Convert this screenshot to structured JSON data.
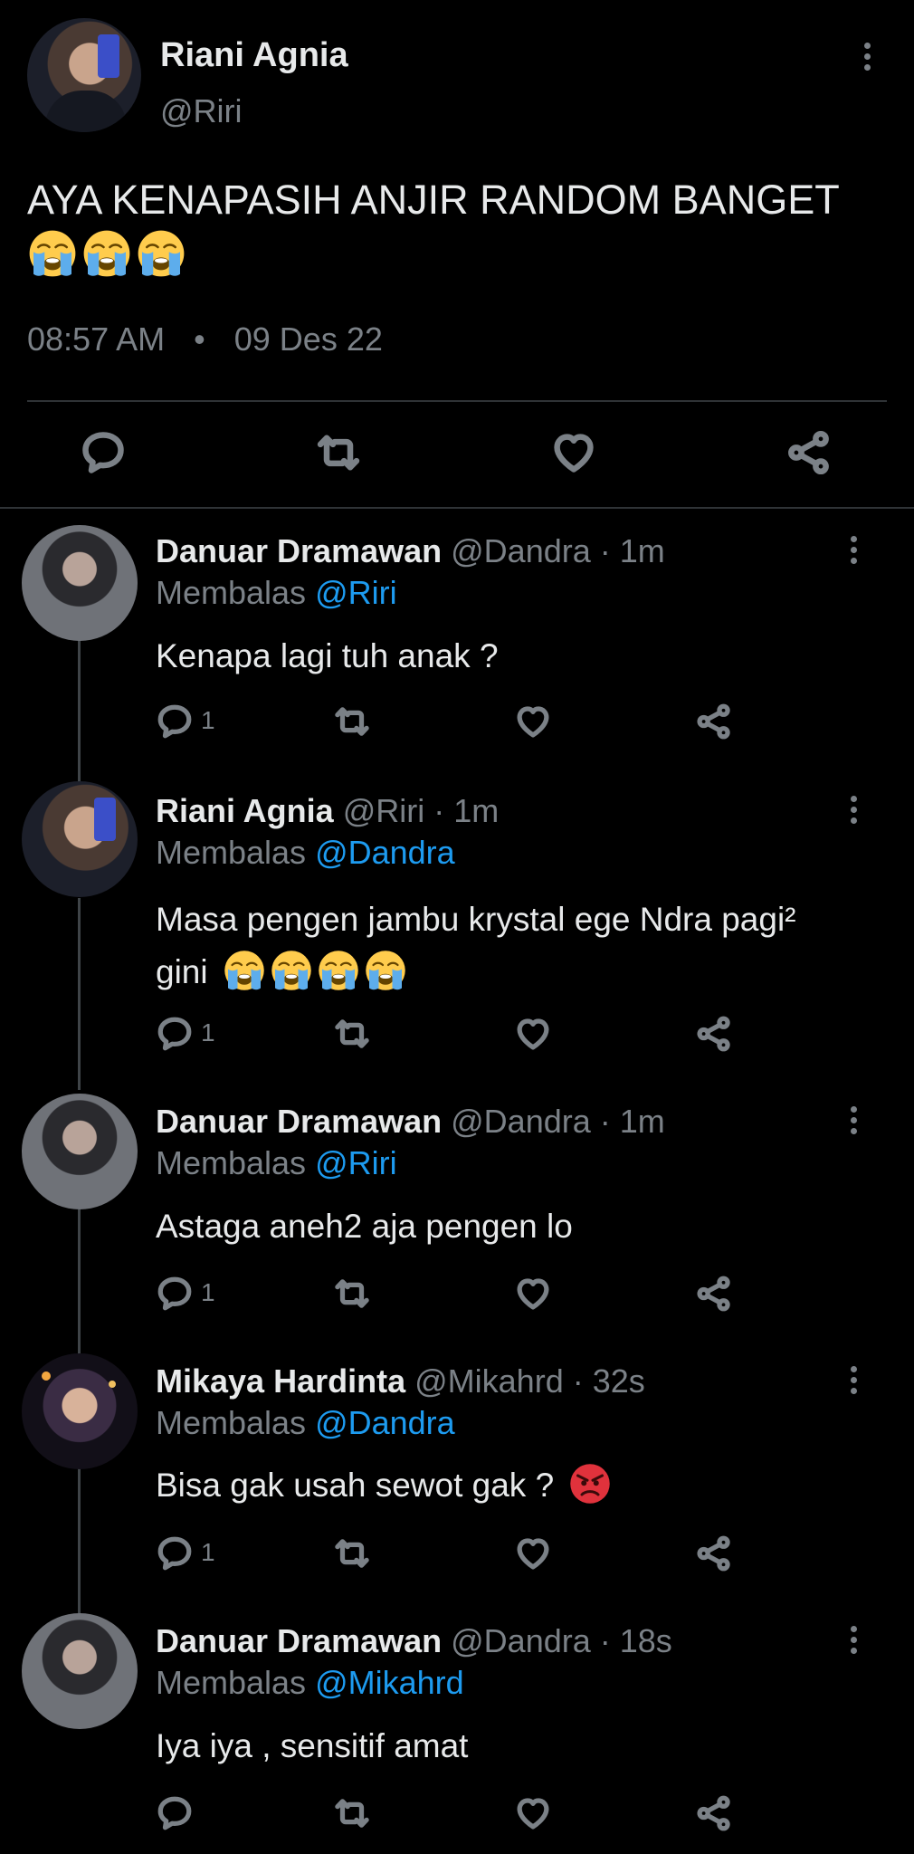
{
  "main_tweet": {
    "name": "Riani Agnia",
    "handle": "@Riri",
    "text": "AYA KENAPASIH ANJIR RANDOM BANGET",
    "emoji": [
      "loudly-crying-face",
      "loudly-crying-face",
      "loudly-crying-face"
    ],
    "time": "08:57 AM",
    "separator": "•",
    "date": "09 Des 22"
  },
  "replies": [
    {
      "name": "Danuar Dramawan",
      "meta": "@Dandra · 1m",
      "reply_prefix": "Membalas",
      "reply_to": "@Riri",
      "text": "Kenapa lagi tuh anak ?",
      "reply_count": "1"
    },
    {
      "name": "Riani Agnia",
      "meta": "@Riri · 1m",
      "reply_prefix": "Membalas",
      "reply_to": "@Dandra",
      "text_line1": "Masa pengen jambu krystal ege Ndra pagi²",
      "text_line2": "gini",
      "emoji": [
        "loudly-crying-face",
        "loudly-crying-face",
        "loudly-crying-face",
        "loudly-crying-face"
      ],
      "reply_count": "1"
    },
    {
      "name": "Danuar Dramawan",
      "meta": "@Dandra · 1m",
      "reply_prefix": "Membalas",
      "reply_to": "@Riri",
      "text": "Astaga aneh2 aja pengen lo",
      "reply_count": "1"
    },
    {
      "name": "Mikaya Hardinta",
      "meta": "@Mikahrd · 32s",
      "reply_prefix": "Membalas",
      "reply_to": "@Dandra",
      "text": "Bisa gak usah sewot gak ?",
      "emoji": [
        "angry-face"
      ],
      "reply_count": "1"
    },
    {
      "name": "Danuar Dramawan",
      "meta": "@Dandra · 18s",
      "reply_prefix": "Membalas",
      "reply_to": "@Mikahrd",
      "text": "Iya iya , sensitif amat",
      "reply_count": ""
    }
  ],
  "colors": {
    "background": "#000000",
    "text": "#e7e9ea",
    "muted": "#7b8187",
    "link": "#1d9bf0",
    "divider": "#2f3336"
  }
}
